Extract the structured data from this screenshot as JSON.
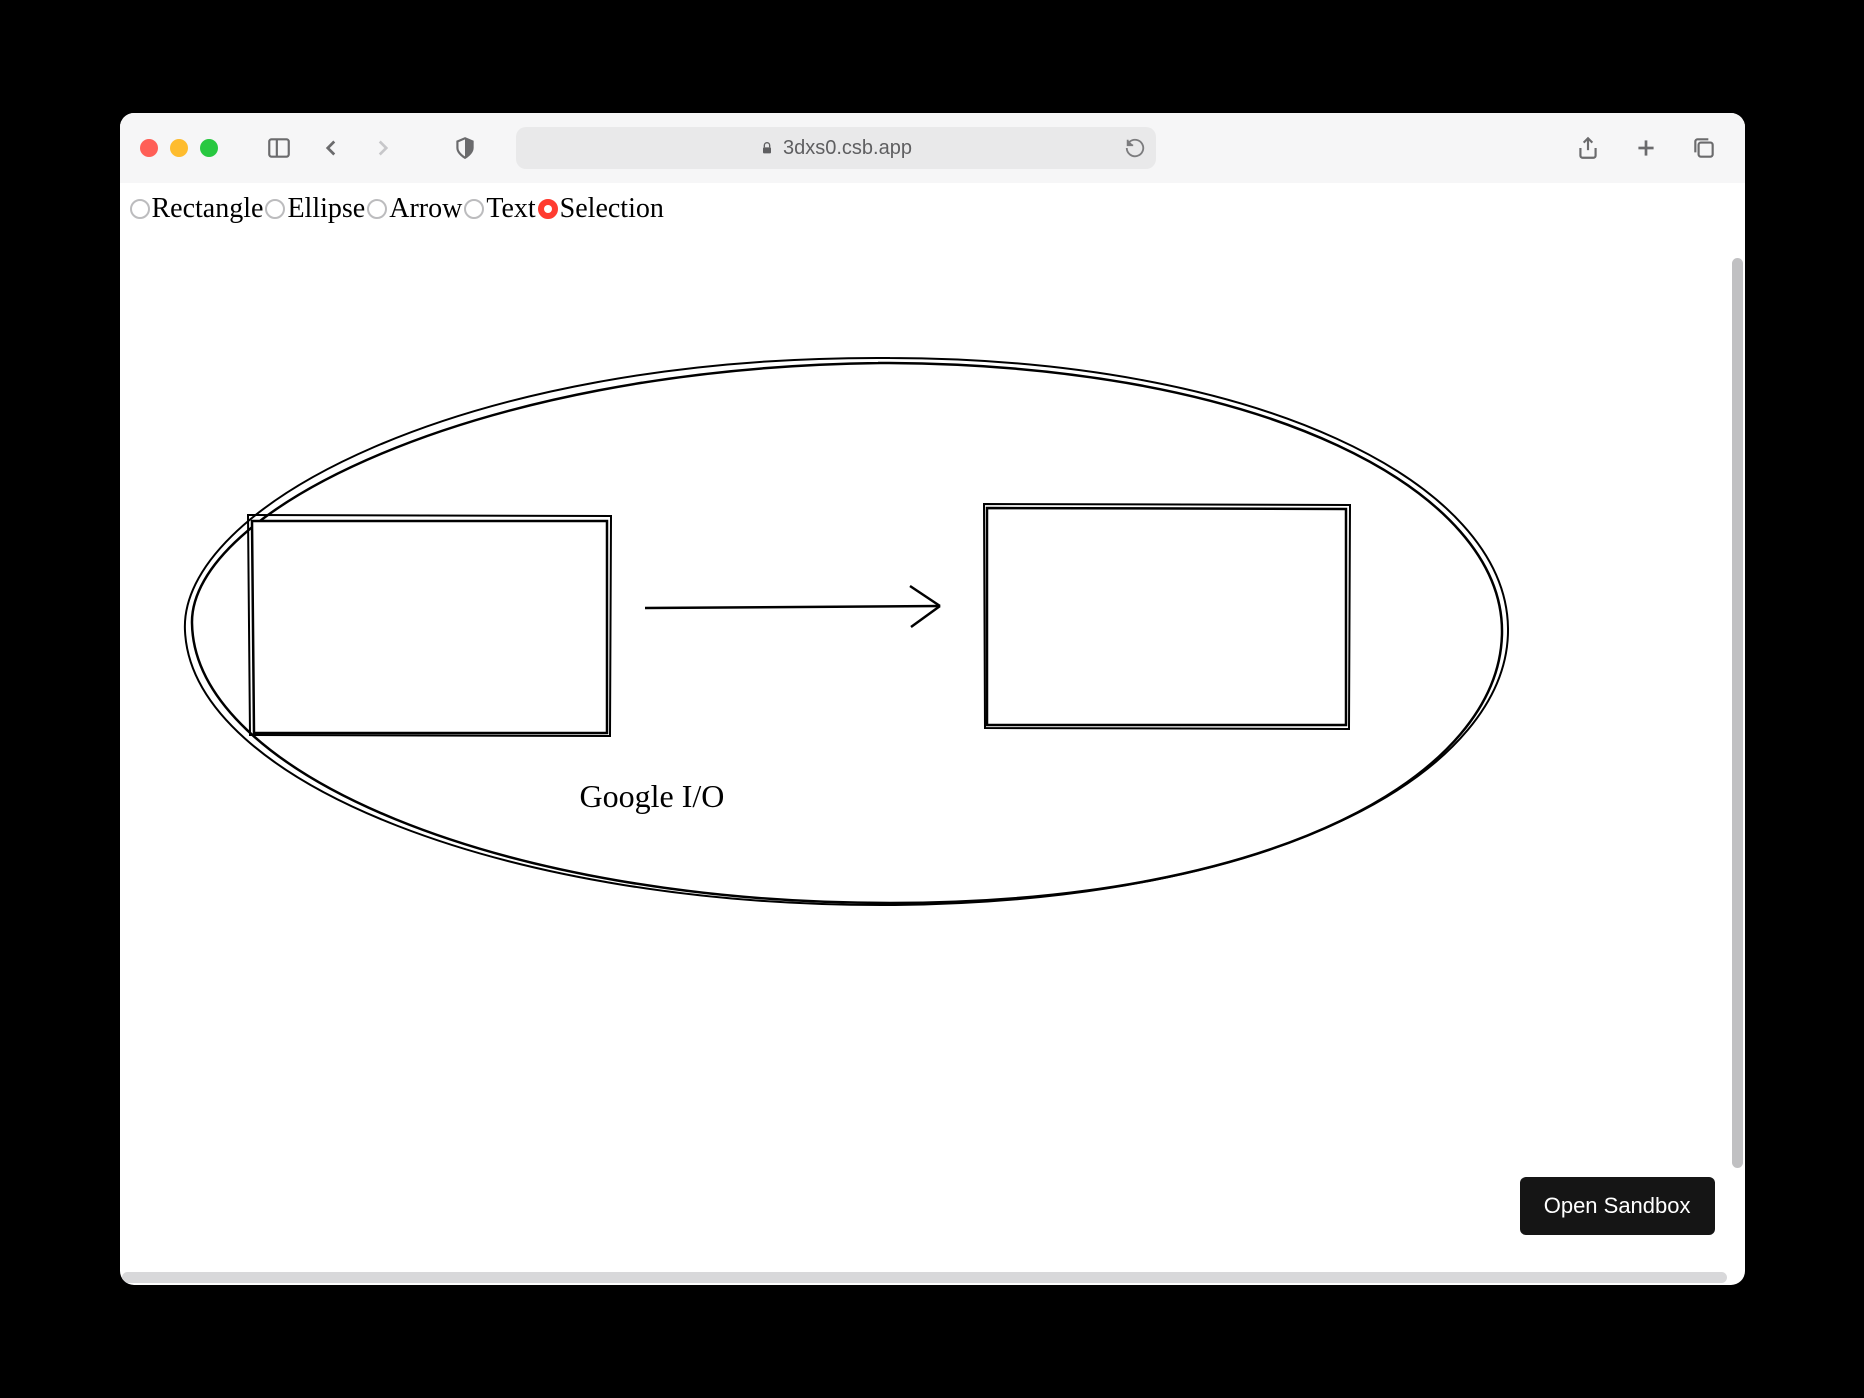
{
  "browser": {
    "url": "3dxs0.csb.app"
  },
  "toolbar": {
    "tools": [
      {
        "label": "Rectangle",
        "checked": false
      },
      {
        "label": "Ellipse",
        "checked": false
      },
      {
        "label": "Arrow",
        "checked": false
      },
      {
        "label": "Text",
        "checked": false
      },
      {
        "label": "Selection",
        "checked": true
      }
    ]
  },
  "canvas": {
    "text_label": "Google I/O"
  },
  "sandbox_button": "Open Sandbox"
}
